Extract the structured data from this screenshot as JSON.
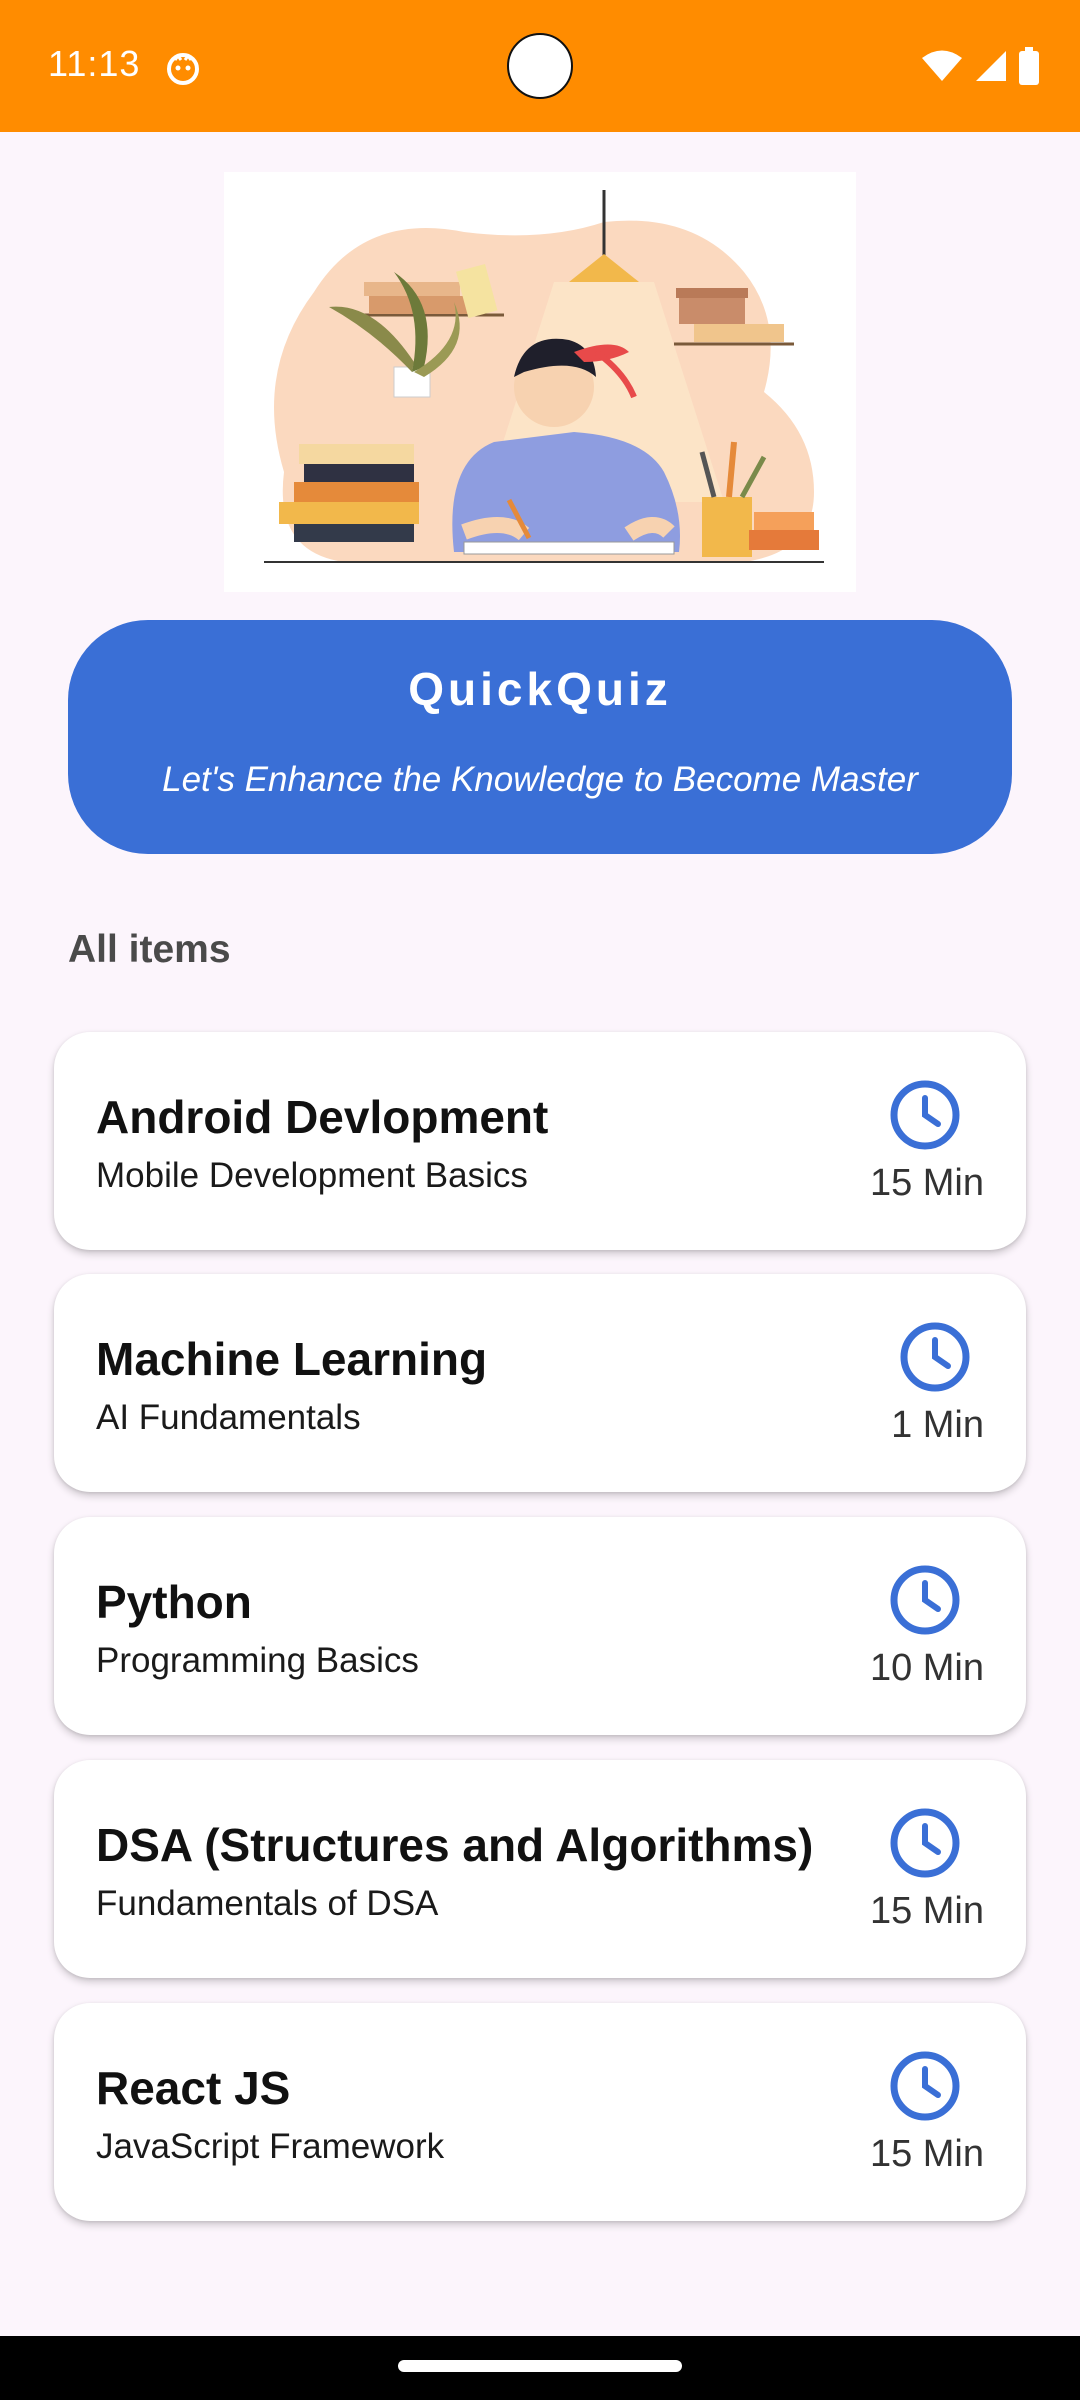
{
  "status_bar": {
    "time": "11:13",
    "background": "#ff8c00",
    "icons": [
      "notification-icon",
      "wifi-icon",
      "cellular-signal-icon",
      "battery-icon"
    ]
  },
  "hero_image": {
    "icon": "student-studying-illustration"
  },
  "banner": {
    "title": "QuickQuiz",
    "subtitle": "Let's Enhance the Knowledge to Become Master",
    "background": "#3a6fd6"
  },
  "section": {
    "heading": "All items"
  },
  "quizzes": [
    {
      "title": "Android Devlopment",
      "subtitle": "Mobile Development Basics",
      "duration": "15 Min",
      "icon": "clock-icon"
    },
    {
      "title": "Machine Learning",
      "subtitle": "AI Fundamentals",
      "duration": "1 Min",
      "icon": "clock-icon"
    },
    {
      "title": "Python",
      "subtitle": "Programming Basics",
      "duration": "10 Min",
      "icon": "clock-icon"
    },
    {
      "title": "DSA (Structures and Algorithms)",
      "subtitle": "Fundamentals of DSA",
      "duration": "15 Min",
      "icon": "clock-icon"
    },
    {
      "title": "React JS",
      "subtitle": "JavaScript Framework",
      "duration": "15 Min",
      "icon": "clock-icon"
    }
  ],
  "colors": {
    "accent": "#3a6fd6",
    "status_bar": "#ff8c00",
    "page_background": "#fcf5fc"
  }
}
